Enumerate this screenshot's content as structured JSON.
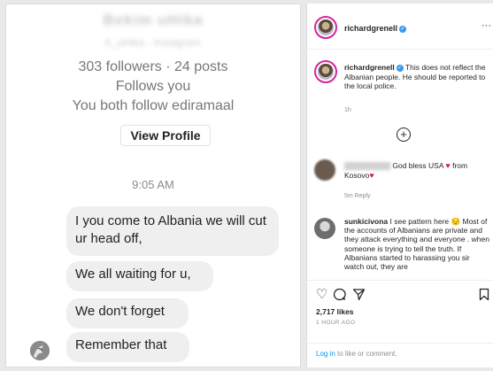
{
  "dm": {
    "profile_name": "Bekim uHika",
    "profile_handle": "b_uHika · Instagram",
    "stats": "303 followers · 24 posts",
    "follows_you": "Follows you",
    "mutual": "You both follow ediramaal",
    "view_profile_label": "View Profile",
    "time": "9:05 AM",
    "messages": [
      "I you come to Albania we will cut ur head off,",
      "We all waiting for u,",
      "We don't forget",
      "Remember that"
    ]
  },
  "post": {
    "username": "richardgrenell",
    "more_icon": "···",
    "caption_username": "richardgrenell",
    "caption_text": "This does not reflect the Albanian people. He should be reported to the local police.",
    "caption_time": "1h",
    "load_more_icon": "⊕",
    "comment1": {
      "text": "God bless USA",
      "suffix": "from Kosovo",
      "meta": "5m   Reply"
    },
    "comment2": {
      "username": "sunkicivona",
      "text": "I see pattern here",
      "emoji": "😔",
      "body": "Most of the accounts of Albanians are private and they attack everything and everyone . when someone is trying to tell the truth. If Albanians started to harassing you sir watch out, they are"
    },
    "likes": "2,717 likes",
    "ago": "1 HOUR AGO",
    "login_link": "Log in",
    "login_rest": " to like or comment."
  },
  "icons": {
    "heart": "heart-icon",
    "comment": "comment-icon",
    "share": "share-icon",
    "bookmark": "bookmark-icon"
  },
  "colors": {
    "verified_blue": "#3897f0",
    "bubble_gray": "#efefef",
    "link_blue": "#0095f6",
    "heart_red": "#d1243a"
  }
}
